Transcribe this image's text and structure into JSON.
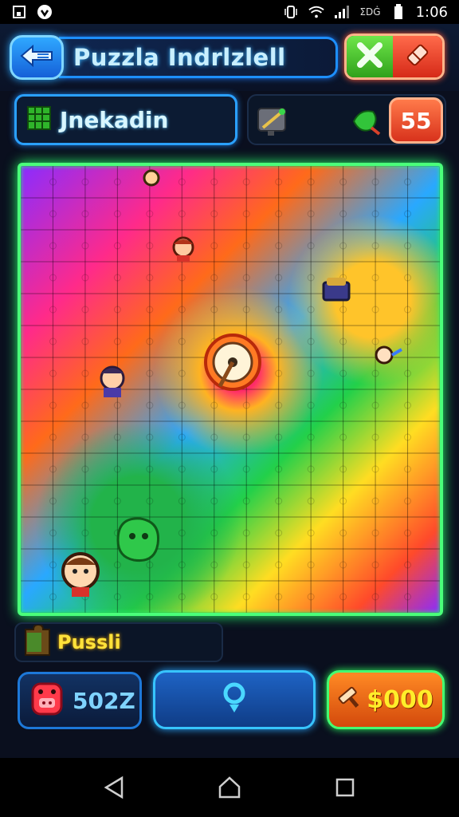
{
  "status_bar": {
    "time": "1:06",
    "carrier": "ΣDĠ"
  },
  "header": {
    "title": "Puzzla Indrlzlell"
  },
  "info": {
    "level_label": "Jnekadin",
    "count": "55"
  },
  "bottom": {
    "hint_label": "Pussli",
    "coins": "502Z",
    "buy_label": "$000"
  },
  "colors": {
    "accent_blue": "#2aa0ff",
    "accent_green": "#4aff7a",
    "accent_orange": "#ff6a3a",
    "board_yellow": "#ffdd22"
  },
  "icons": {
    "back": "back-arrow-icon",
    "close": "close-icon",
    "erase": "eraser-icon",
    "level": "grid-icon",
    "tool": "wand-icon",
    "gem": "leaf-icon",
    "hint": "piece-icon",
    "coins": "pig-icon",
    "center": "location-pin-icon",
    "buy": "hammer-icon"
  }
}
